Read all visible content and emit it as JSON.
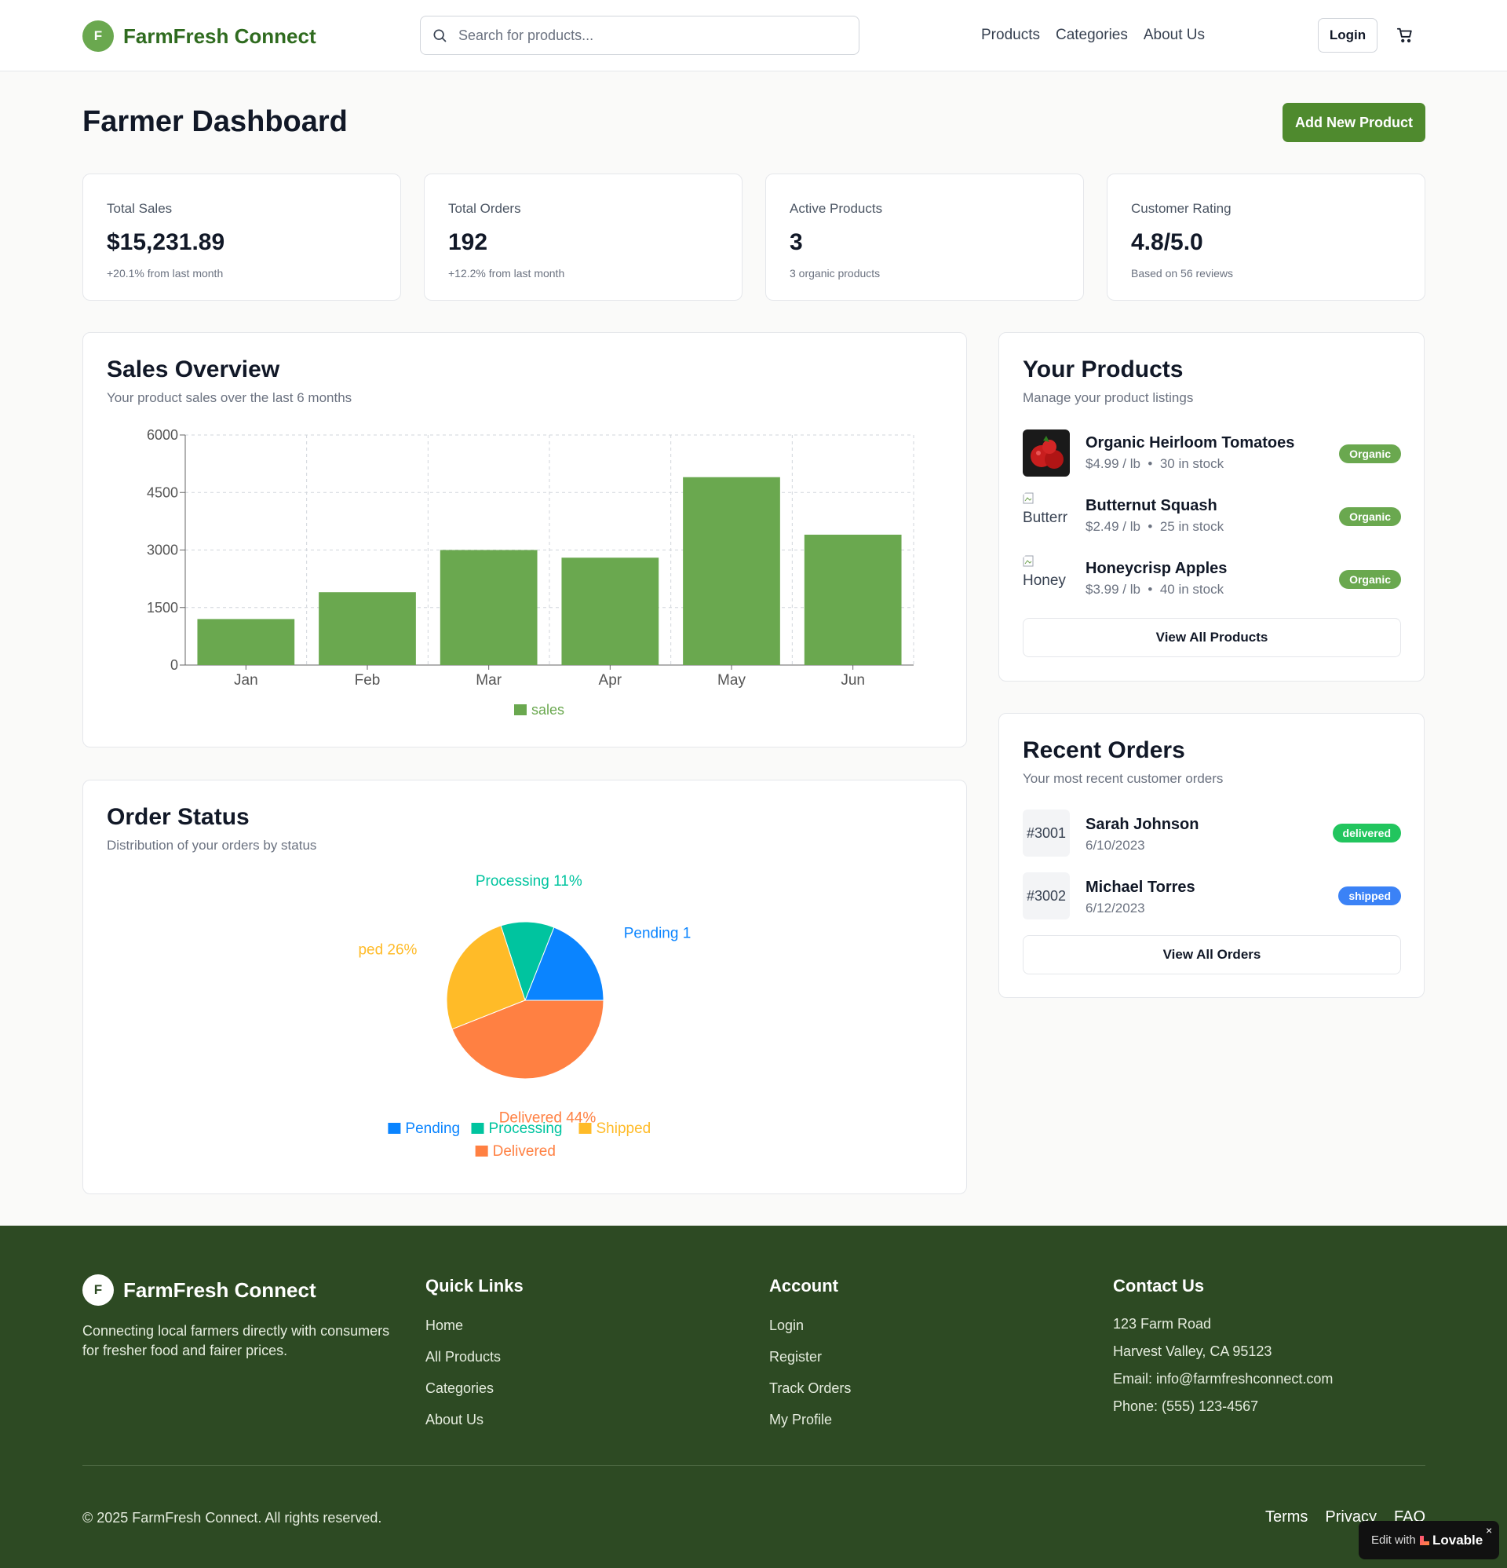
{
  "header": {
    "logo_letter": "F",
    "brand": "FarmFresh Connect",
    "search_placeholder": "Search for products...",
    "nav": [
      "Products",
      "Categories",
      "About Us"
    ],
    "login": "Login"
  },
  "page": {
    "title": "Farmer Dashboard",
    "add_button": "Add New Product"
  },
  "stats": [
    {
      "label": "Total Sales",
      "value": "$15,231.89",
      "sub": "+20.1% from last month"
    },
    {
      "label": "Total Orders",
      "value": "192",
      "sub": "+12.2% from last month"
    },
    {
      "label": "Active Products",
      "value": "3",
      "sub": "3 organic products"
    },
    {
      "label": "Customer Rating",
      "value": "4.8/5.0",
      "sub": "Based on 56 reviews"
    }
  ],
  "sales_overview": {
    "title": "Sales Overview",
    "desc": "Your product sales over the last 6 months"
  },
  "order_status": {
    "title": "Order Status",
    "desc": "Distribution of your orders by status"
  },
  "chart_data": [
    {
      "type": "bar",
      "categories": [
        "Jan",
        "Feb",
        "Mar",
        "Apr",
        "May",
        "Jun"
      ],
      "series": [
        {
          "name": "sales",
          "values": [
            1200,
            1900,
            3000,
            2800,
            4900,
            3400
          ]
        }
      ],
      "yticks": [
        0,
        1500,
        3000,
        4500,
        6000
      ],
      "ylim": [
        0,
        6000
      ],
      "grid": true,
      "legend": "bottom",
      "color": "#6aa84f"
    },
    {
      "type": "pie",
      "slices": [
        {
          "label": "Pending",
          "value": 19,
          "color": "#0a84ff",
          "outer_label": "Pending 1"
        },
        {
          "label": "Processing",
          "value": 11,
          "color": "#00c49f",
          "outer_label": "Processing 11%"
        },
        {
          "label": "Shipped",
          "value": 26,
          "color": "#ffbb28",
          "outer_label": "ped 26%"
        },
        {
          "label": "Delivered",
          "value": 44,
          "color": "#ff8042",
          "outer_label": "Delivered 44%"
        }
      ],
      "legend": "bottom"
    }
  ],
  "products": {
    "title": "Your Products",
    "desc": "Manage your product listings",
    "items": [
      {
        "name": "Organic Heirloom Tomatoes",
        "price": "$4.99 / lb",
        "stock": "30 in stock",
        "badge": "Organic",
        "alt": ""
      },
      {
        "name": "Butternut Squash",
        "price": "$2.49 / lb",
        "stock": "25 in stock",
        "badge": "Organic",
        "alt": "Butterr"
      },
      {
        "name": "Honeycrisp Apples",
        "price": "$3.99 / lb",
        "stock": "40 in stock",
        "badge": "Organic",
        "alt": "Honey"
      }
    ],
    "bullet": "•",
    "view_all": "View All Products",
    "badge_color": "#6aa84f"
  },
  "orders": {
    "title": "Recent Orders",
    "desc": "Your most recent customer orders",
    "items": [
      {
        "id": "#3001",
        "customer": "Sarah Johnson",
        "date": "6/10/2023",
        "status": "delivered",
        "color": "#22c55e"
      },
      {
        "id": "#3002",
        "customer": "Michael Torres",
        "date": "6/12/2023",
        "status": "shipped",
        "color": "#3b82f6"
      }
    ],
    "view_all": "View All Orders"
  },
  "footer": {
    "brand": "FarmFresh Connect",
    "logo_letter": "F",
    "tagline": "Connecting local farmers directly with consumers for fresher food and fairer prices.",
    "quick_links": {
      "title": "Quick Links",
      "links": [
        "Home",
        "All Products",
        "Categories",
        "About Us"
      ]
    },
    "account": {
      "title": "Account",
      "links": [
        "Login",
        "Register",
        "Track Orders",
        "My Profile"
      ]
    },
    "contact": {
      "title": "Contact Us",
      "lines": [
        "123 Farm Road",
        "Harvest Valley, CA 95123",
        "Email: info@farmfreshconnect.com",
        "Phone: (555) 123-4567"
      ]
    },
    "copyright": "© 2025 FarmFresh Connect. All rights reserved.",
    "bottom_links": [
      "Terms",
      "Privacy",
      "FAQ"
    ]
  },
  "lovable": {
    "edit": "Edit with",
    "brand": "Lovable",
    "close": "×"
  },
  "colors": {
    "primary": "#4f8a2e",
    "logo_green": "#6aa84f",
    "footer_bg": "#2d4a23"
  }
}
